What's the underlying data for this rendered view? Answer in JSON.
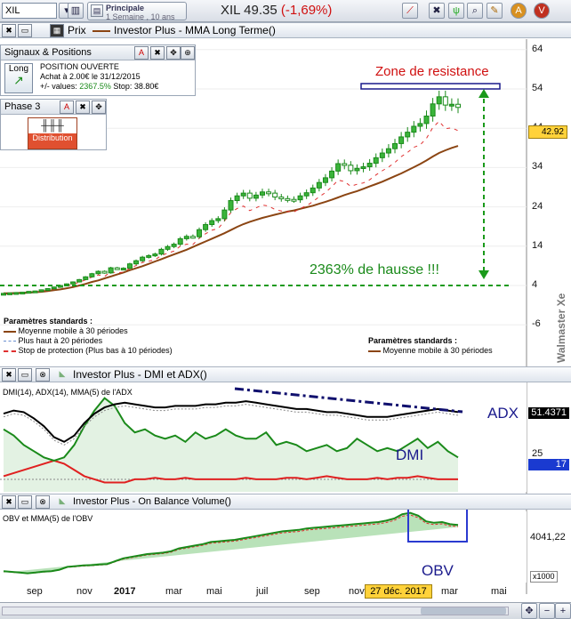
{
  "toolbar": {
    "ticker": "XIL",
    "period_line1": "Principale",
    "period_line2": "1 Semaine , 10 ans",
    "symbol": "XIL",
    "price": "49.35",
    "change": "(-1,69%)"
  },
  "price_panel": {
    "tab_label": "Prix",
    "title": "Investor Plus - MMA Long Terme()",
    "price_tag": "42.92",
    "watermark": "Walmaster Xe"
  },
  "signals_box": {
    "header": "Signaux & Positions",
    "badge": "Long",
    "line1": "POSITION OUVERTE",
    "line2": "Achat à 2.00€ le 31/12/2015",
    "line3_prefix": "+/- values:",
    "line3_value": "2367.5%",
    "line3_stop": "Stop: 38.80€"
  },
  "phase_box": {
    "header": "Phase 3",
    "badge": "Distribution"
  },
  "legend_left": {
    "title": "Paramètres standards :",
    "items": [
      {
        "label": "Moyenne mobile à 30 périodes",
        "color": "#8b4513"
      },
      {
        "label": "Plus haut à 20 périodes",
        "color": "#6a8fd0"
      },
      {
        "label": "Stop de protection (Plus bas à 10 périodes)",
        "color": "#e03030"
      }
    ]
  },
  "legend_right": {
    "title": "Paramètres standards :",
    "item": "Moyenne mobile à 30 périodes"
  },
  "annotations": {
    "resistance": "Zone de resistance",
    "hausse": "2363% de hausse !!!",
    "adx": "ADX",
    "dmi": "DMI",
    "obv": "OBV"
  },
  "dmi_panel": {
    "title": "Investor Plus - DMI et ADX()",
    "subtitle": "DMI(14), ADX(14), MMA(5) de l'ADX",
    "tag_adx": "51.4371",
    "tag_dmi": "17",
    "tick": "25"
  },
  "obv_panel": {
    "title": "Investor Plus - On Balance Volume()",
    "subtitle": "OBV et MMA(5) de l'OBV",
    "tick": "4041,22",
    "scale": "x1000"
  },
  "date_tooltip": "27 déc. 2017",
  "chart_data": {
    "type": "candlestick",
    "title": "Investor Plus - MMA Long Terme()",
    "ylim": [
      -6,
      64
    ],
    "y_ticks": [
      64,
      54,
      44,
      34,
      24,
      14,
      4,
      -6
    ],
    "x_ticks": [
      "sep",
      "nov",
      "2017",
      "mar",
      "mai",
      "juil",
      "sep",
      "nov",
      "janv",
      "mar",
      "mai"
    ],
    "close": [
      2.0,
      2.1,
      2.2,
      2.3,
      2.5,
      2.6,
      2.9,
      3.2,
      3.6,
      4.0,
      4.4,
      4.9,
      5.5,
      6.2,
      7.0,
      7.6,
      7.2,
      8.5,
      8.2,
      8.4,
      9.5,
      10.3,
      11.2,
      11.6,
      12.0,
      13.2,
      13.9,
      14.5,
      15.9,
      16.5,
      16.4,
      18.2,
      19.5,
      20.5,
      21.0,
      23.2,
      25.6,
      26.8,
      27.5,
      26.2,
      27.0,
      27.8,
      27.5,
      26.5,
      26.1,
      25.9,
      25.8,
      26.8,
      27.6,
      28.8,
      30.2,
      31.4,
      33.1,
      35.0,
      34.6,
      33.2,
      33.8,
      34.2,
      35.1,
      36.5,
      37.7,
      38.8,
      40.1,
      41.8,
      43.0,
      44.5,
      45.2,
      47.1,
      50.2,
      52.0,
      49.9,
      50.1,
      49.3
    ],
    "series": [
      {
        "name": "Moyenne mobile à 30 périodes",
        "values": [
          2.0,
          2.0,
          2.1,
          2.1,
          2.2,
          2.3,
          2.4,
          2.6,
          2.8,
          3.0,
          3.3,
          3.6,
          4.0,
          4.4,
          4.9,
          5.3,
          5.8,
          6.3,
          6.8,
          7.3,
          7.9,
          8.4,
          8.9,
          9.5,
          10.1,
          10.7,
          11.3,
          11.9,
          12.5,
          13.1,
          13.8,
          14.5,
          15.2,
          15.9,
          16.6,
          17.3,
          18.1,
          18.9,
          19.6,
          20.2,
          20.7,
          21.2,
          21.6,
          22.0,
          22.4,
          22.8,
          23.1,
          23.5,
          23.9,
          24.3,
          24.8,
          25.3,
          25.8,
          26.4,
          27.0,
          27.5,
          28.0,
          28.6,
          29.2,
          29.8,
          30.4,
          31.1,
          31.8,
          32.5,
          33.3,
          34.1,
          34.9,
          35.8,
          36.8,
          37.7,
          38.4,
          39.0,
          39.5
        ]
      }
    ],
    "annotations_values": {
      "resistance_level": 54,
      "base_level": 4
    }
  },
  "dmi_data": {
    "type": "line",
    "ylim": [
      0,
      70
    ],
    "series": [
      {
        "name": "ADX",
        "values": [
          50,
          52,
          51,
          47,
          42,
          35,
          32,
          36,
          44,
          50,
          54,
          56,
          57,
          56,
          55,
          54,
          54,
          55,
          55,
          55,
          56,
          56,
          57,
          57,
          58,
          57,
          56,
          55,
          54,
          53,
          53,
          52,
          51,
          51,
          50,
          49,
          48,
          48,
          48,
          49,
          50,
          51,
          52,
          53,
          52,
          51
        ]
      },
      {
        "name": "DMI+",
        "values": [
          40,
          36,
          30,
          26,
          22,
          20,
          22,
          30,
          42,
          52,
          60,
          55,
          44,
          38,
          40,
          36,
          34,
          36,
          32,
          38,
          34,
          36,
          40,
          36,
          34,
          34,
          38,
          30,
          32,
          30,
          26,
          28,
          30,
          26,
          28,
          34,
          30,
          26,
          28,
          26,
          30,
          34,
          28,
          32,
          26,
          22
        ]
      },
      {
        "name": "DMI-",
        "values": [
          10,
          12,
          14,
          16,
          18,
          20,
          18,
          14,
          10,
          8,
          6,
          6,
          6,
          8,
          8,
          9,
          8,
          8,
          9,
          8,
          8,
          8,
          8,
          8,
          9,
          8,
          8,
          8,
          9,
          9,
          8,
          9,
          10,
          9,
          8,
          8,
          8,
          9,
          8,
          9,
          9,
          10,
          9,
          8,
          8,
          8
        ]
      }
    ]
  },
  "obv_data": {
    "type": "area",
    "ylim": [
      0,
      5000
    ],
    "series": [
      {
        "name": "OBV",
        "values": [
          800,
          750,
          700,
          650,
          700,
          760,
          800,
          900,
          1100,
          1150,
          1200,
          1220,
          1260,
          1300,
          1500,
          1700,
          1800,
          1900,
          2000,
          2050,
          2100,
          2200,
          2400,
          2500,
          2600,
          2700,
          2850,
          2900,
          2950,
          3000,
          3100,
          3200,
          3300,
          3400,
          3500,
          3600,
          3650,
          3700,
          3800,
          3850,
          3900,
          3950,
          4000,
          4050,
          4100,
          4150,
          4200,
          4250,
          4350,
          4500,
          4800,
          4900,
          4700,
          4300,
          4200,
          4250,
          4100,
          4050
        ]
      }
    ]
  }
}
